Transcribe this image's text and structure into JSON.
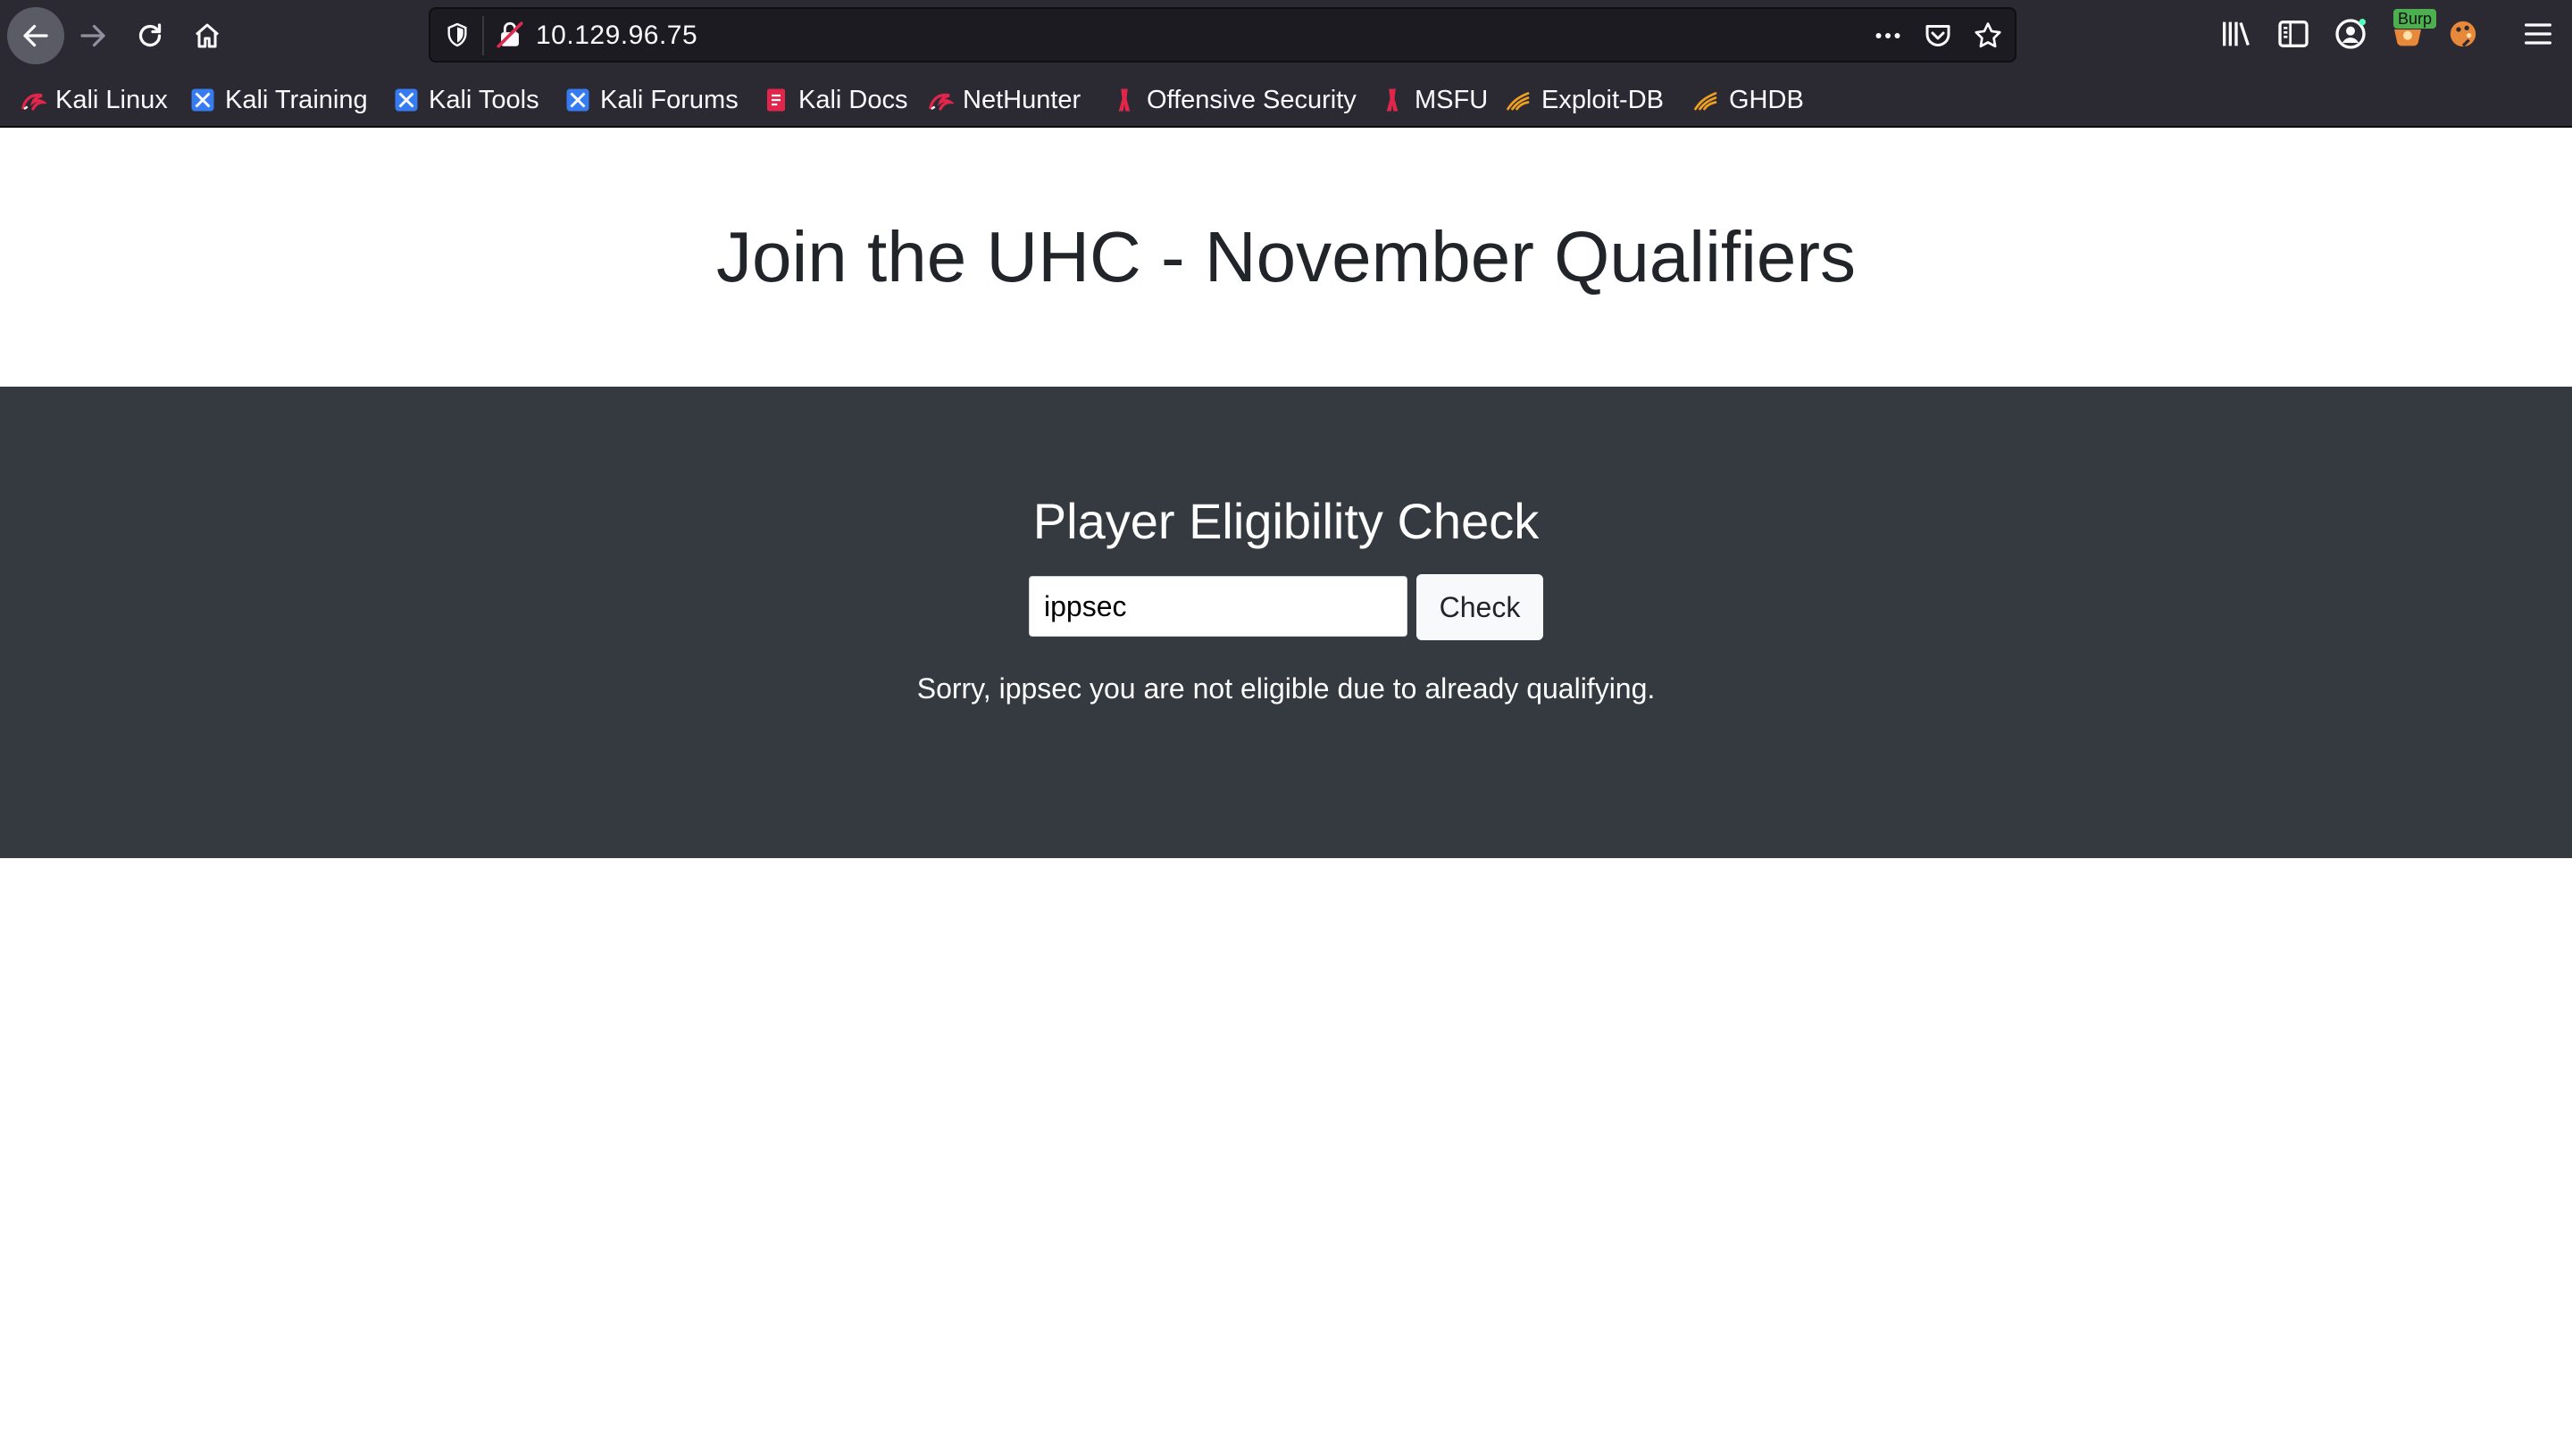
{
  "browser": {
    "url": "10.129.96.75",
    "toolbar_icons": [
      "back-icon",
      "forward-icon",
      "reload-icon",
      "home-icon",
      "shield-icon",
      "insecure-connection-icon",
      "page-actions-icon",
      "pocket-icon",
      "bookmark-star-icon",
      "library-icon",
      "sidebar-icon",
      "account-icon",
      "burp-extension-icon",
      "extension-icon",
      "menu-icon"
    ],
    "burp_badge": "Burp",
    "bookmarks": [
      {
        "label": "Kali Linux",
        "icon": "kali-dragon-icon"
      },
      {
        "label": "Kali Training",
        "icon": "kali-tools-icon"
      },
      {
        "label": "Kali Tools",
        "icon": "kali-tools-icon"
      },
      {
        "label": "Kali Forums",
        "icon": "kali-tools-icon"
      },
      {
        "label": "Kali Docs",
        "icon": "kali-docs-icon"
      },
      {
        "label": "NetHunter",
        "icon": "kali-dragon-icon"
      },
      {
        "label": "Offensive Security",
        "icon": "offsec-icon"
      },
      {
        "label": "MSFU",
        "icon": "offsec-icon"
      },
      {
        "label": "Exploit-DB",
        "icon": "exploit-db-icon"
      },
      {
        "label": "GHDB",
        "icon": "exploit-db-icon"
      }
    ]
  },
  "page": {
    "title": "Join the UHC - November Qualifiers",
    "form": {
      "heading": "Player Eligibility Check",
      "input_value": "ippsec",
      "button_label": "Check",
      "result": "Sorry, ippsec you are not eligible due to already qualifying."
    }
  },
  "colors": {
    "chrome_bg": "#2b2a33",
    "urlbar_bg": "#1c1b22",
    "section_bg": "#343a40",
    "title_text": "#212529"
  }
}
